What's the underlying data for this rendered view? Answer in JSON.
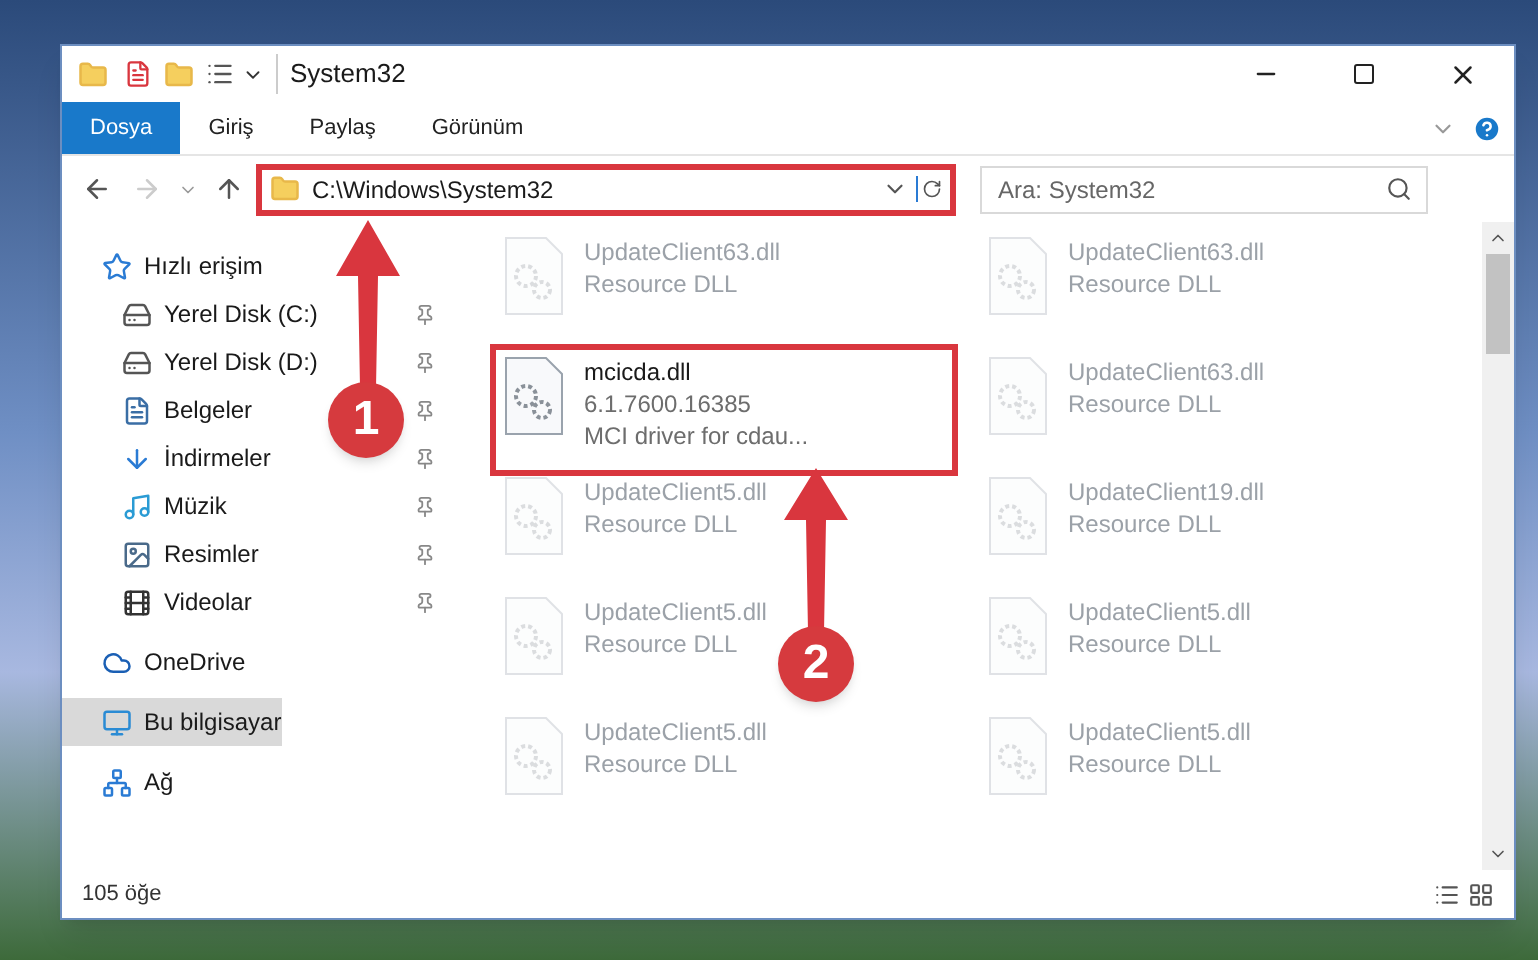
{
  "window": {
    "title": "System32"
  },
  "ribbon_tabs": [
    {
      "label": "Dosya",
      "selected": true
    },
    {
      "label": "Giriş",
      "selected": false
    },
    {
      "label": "Paylaş",
      "selected": false
    },
    {
      "label": "Görünüm",
      "selected": false
    }
  ],
  "address_bar": {
    "path": "C:\\Windows\\System32",
    "highlighted": true
  },
  "search": {
    "placeholder": "Ara: System32"
  },
  "sidebar": {
    "items": [
      {
        "label": "Hızlı erişim",
        "selected": false,
        "children": [
          {
            "label": "Yerel Disk (C:)",
            "selected": false,
            "pinned": true
          },
          {
            "label": "Yerel Disk (D:)",
            "selected": false,
            "pinned": true
          },
          {
            "label": "Belgeler",
            "selected": false,
            "pinned": true
          },
          {
            "label": "İndirmeler",
            "selected": false,
            "pinned": true
          },
          {
            "label": "Müzik",
            "selected": false,
            "pinned": true
          },
          {
            "label": "Resimler",
            "selected": false,
            "pinned": true
          },
          {
            "label": "Videolar",
            "selected": false,
            "pinned": true
          }
        ]
      },
      {
        "label": "OneDrive",
        "selected": false
      },
      {
        "label": "Bu bilgisayar",
        "selected": true
      },
      {
        "label": "Ağ",
        "selected": false
      }
    ]
  },
  "files": [
    {
      "name": "UpdateClient63.dll",
      "lines": [
        "Resource DLL"
      ],
      "highlighted": false,
      "faded": true
    },
    {
      "name": "UpdateClient63.dll",
      "lines": [
        "Resource DLL"
      ],
      "highlighted": false,
      "faded": true
    },
    {
      "name": "mcicda.dll",
      "lines": [
        "6.1.7600.16385",
        "MCI driver for cdau..."
      ],
      "highlighted": true,
      "faded": false
    },
    {
      "name": "UpdateClient63.dll",
      "lines": [
        "Resource DLL"
      ],
      "highlighted": false,
      "faded": true
    },
    {
      "name": "UpdateClient5.dll",
      "lines": [
        "Resource DLL"
      ],
      "highlighted": false,
      "faded": true
    },
    {
      "name": "UpdateClient19.dll",
      "lines": [
        "Resource DLL"
      ],
      "highlighted": false,
      "faded": true
    },
    {
      "name": "UpdateClient5.dll",
      "lines": [
        "Resource DLL"
      ],
      "highlighted": false,
      "faded": true
    },
    {
      "name": "UpdateClient5.dll",
      "lines": [
        "Resource DLL"
      ],
      "highlighted": false,
      "faded": true
    },
    {
      "name": "UpdateClient5.dll",
      "lines": [
        "Resource DLL"
      ],
      "highlighted": false,
      "faded": true
    },
    {
      "name": "UpdateClient5.dll",
      "lines": [
        "Resource DLL"
      ],
      "highlighted": false,
      "faded": true
    }
  ],
  "status_bar": {
    "count": "105 öğe"
  },
  "annotations": [
    {
      "label": "1"
    },
    {
      "label": "2"
    }
  ]
}
